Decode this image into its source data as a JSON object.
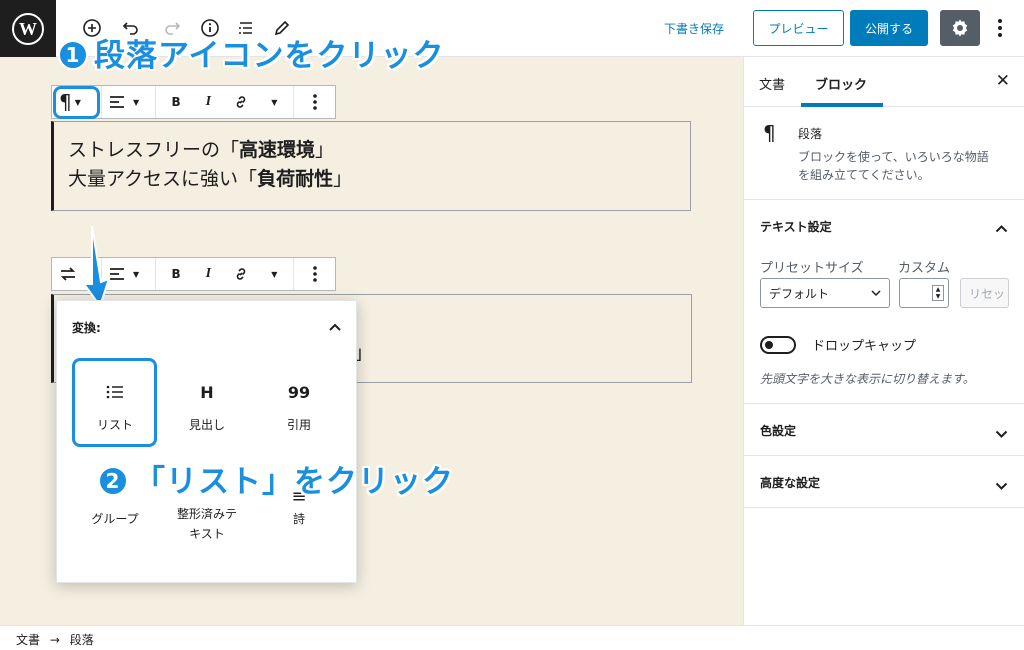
{
  "topbar": {
    "icons": [
      "wordpress-icon",
      "add-block-icon",
      "undo-icon",
      "redo-icon",
      "info-icon",
      "outline-icon",
      "edit-icon"
    ],
    "save_draft": "下書き保存",
    "preview": "プレビュー",
    "publish": "公開する",
    "settings_icon": "gear-icon",
    "more_icon": "more-vertical-icon"
  },
  "block1": {
    "toolbar_icons": [
      "paragraph-icon",
      "align-left-icon",
      "bold-icon",
      "italic-icon",
      "link-icon",
      "more-rich-text-icon",
      "more-vertical-icon"
    ],
    "line1_plain": "ストレスフリーの「",
    "line1_bold": "高速環境",
    "line1_end": "」",
    "line2_plain": "大量アクセスに強い「",
    "line2_bold": "負荷耐性",
    "line2_end": "」"
  },
  "block2": {
    "toolbar_icons": [
      "transform-icon",
      "align-left-icon",
      "bold-icon",
      "italic-icon",
      "link-icon",
      "more-rich-text-icon",
      "more-vertical-icon"
    ],
    "visible_text": "」"
  },
  "popup": {
    "title": "変換:",
    "items": [
      {
        "label": "リスト",
        "icon": "list-icon"
      },
      {
        "label": "見出し",
        "icon": "heading-icon"
      },
      {
        "label": "引用",
        "icon": "quote-icon"
      },
      {
        "label": "グループ",
        "icon": "group-icon"
      },
      {
        "label": "整形済みテキスト",
        "icon": "preformatted-icon"
      },
      {
        "label": "詩",
        "icon": "verse-icon"
      }
    ]
  },
  "annotations": {
    "step1_num": "1",
    "step1_text": "段落アイコンをクリック",
    "step2_num": "2",
    "step2_text": "「リスト」をクリック"
  },
  "sidebar": {
    "tab_document": "文書",
    "tab_block": "ブロック",
    "close_icon": "close-icon",
    "block_name": "段落",
    "block_desc_1": "ブロックを使って、いろいろな物語",
    "block_desc_2": "を組み立ててください。",
    "text_settings": "テキスト設定",
    "preset_size": "プリセットサイズ",
    "custom": "カスタム",
    "default_option": "デフォルト",
    "reset": "リセット",
    "drop_cap": "ドロップキャップ",
    "drop_cap_help": "先頭文字を大きな表示に切り替えます。",
    "color_settings": "色設定",
    "advanced": "高度な設定"
  },
  "footer": {
    "crumb1": "文書",
    "arrow": "→",
    "crumb2": "段落"
  },
  "colors": {
    "accent": "#007cba",
    "annotation": "#1a8fe0",
    "canvas_bg": "#f4efe0"
  }
}
